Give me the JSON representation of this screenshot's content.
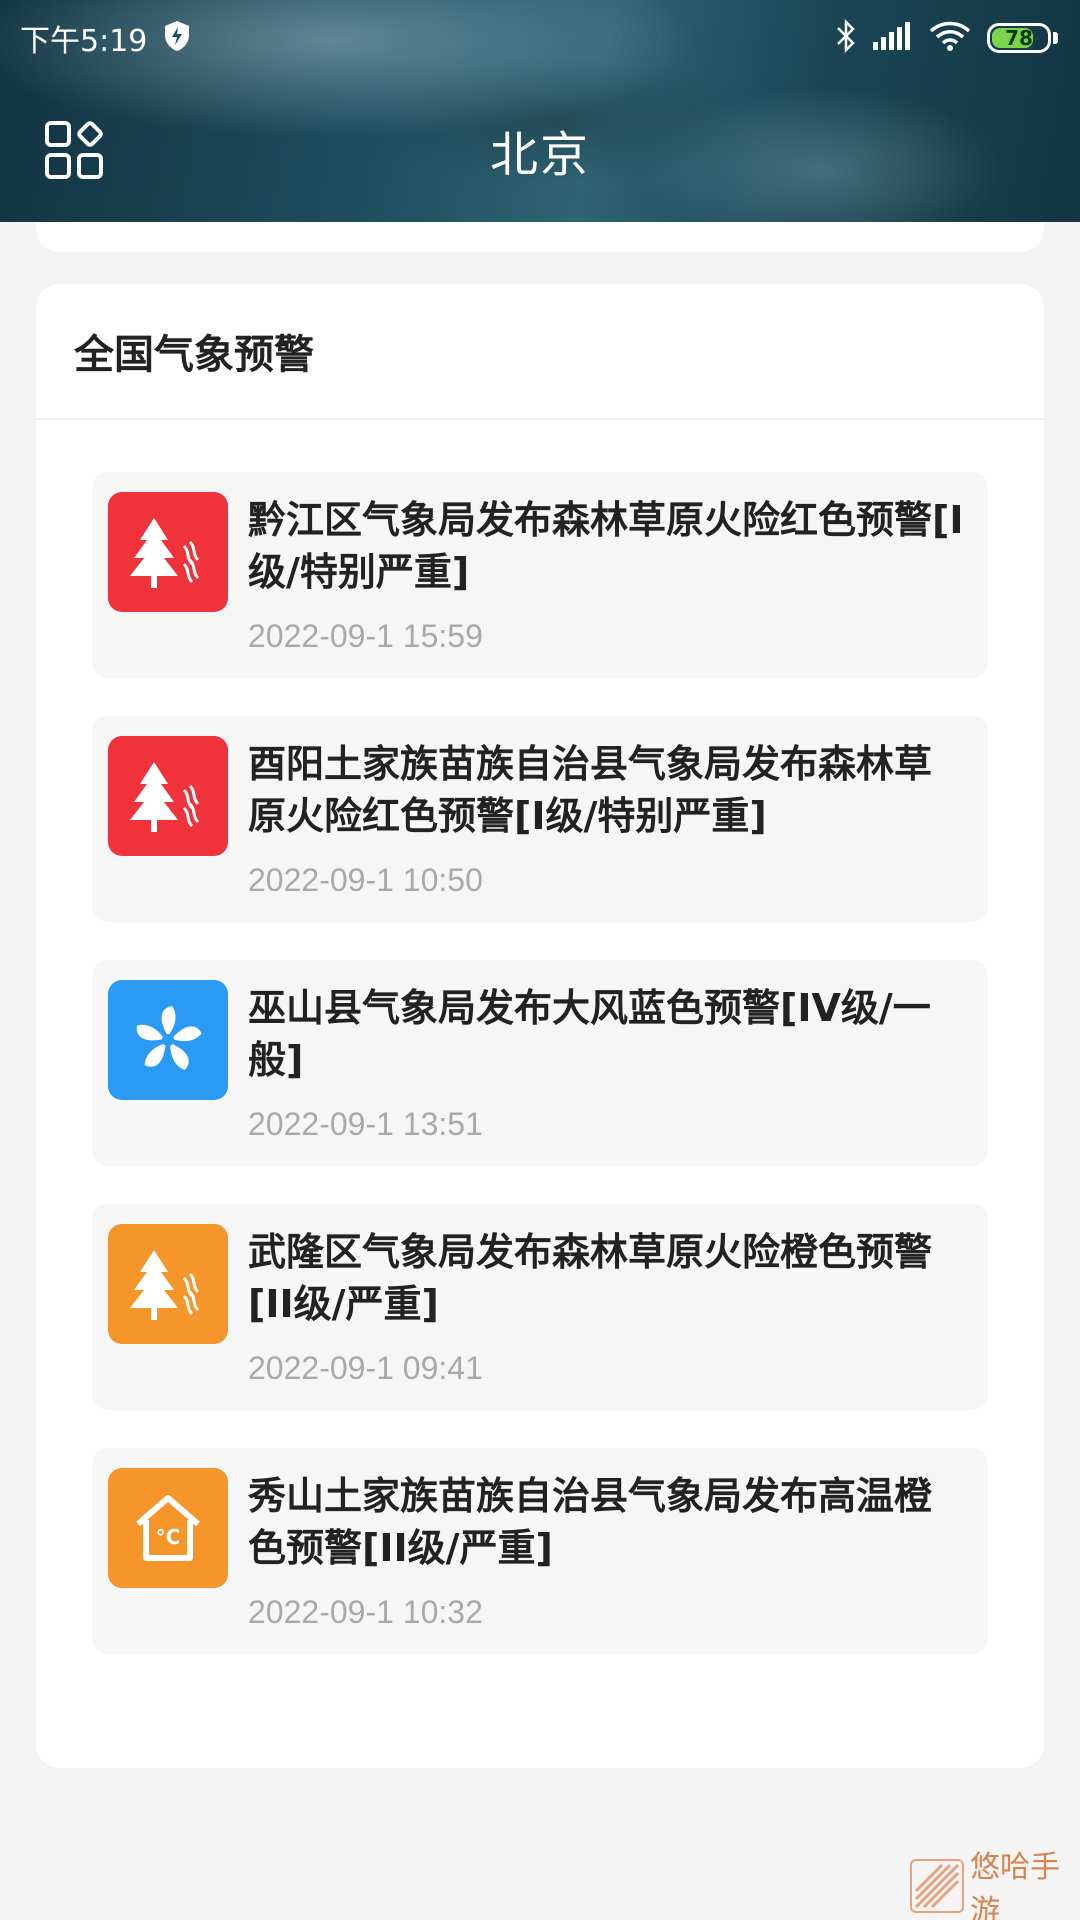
{
  "status_bar": {
    "time": "下午5:19",
    "battery": "78",
    "battery_level": 0.78,
    "icons": [
      "shield-bolt-icon",
      "bluetooth-icon",
      "signal-icon",
      "wifi-icon",
      "battery-icon"
    ]
  },
  "header": {
    "city": "北京",
    "menu_icon": "grid-menu-icon"
  },
  "warnings": {
    "title": "全国气象预警",
    "items": [
      {
        "text": "黔江区气象局发布森林草原火险红色预警[I级/特别严重]",
        "time": "2022-09-1 15:59",
        "color": "#f0323a",
        "icon": "forest-fire-icon"
      },
      {
        "text": "酉阳土家族苗族自治县气象局发布森林草原火险红色预警[I级/特别严重]",
        "time": "2022-09-1 10:50",
        "color": "#f0323a",
        "icon": "forest-fire-icon"
      },
      {
        "text": "巫山县气象局发布大风蓝色预警[IV级/一般]",
        "time": "2022-09-1 13:51",
        "color": "#2a9af5",
        "icon": "wind-icon"
      },
      {
        "text": "武隆区气象局发布森林草原火险橙色预警[II级/严重]",
        "time": "2022-09-1 09:41",
        "color": "#f6952a",
        "icon": "forest-fire-icon"
      },
      {
        "text": "秀山土家族苗族自治县气象局发布高温橙色预警[II级/严重]",
        "time": "2022-09-1 10:32",
        "color": "#f6952a",
        "icon": "high-temperature-icon"
      }
    ]
  },
  "watermark": {
    "text": "悠哈手游"
  }
}
